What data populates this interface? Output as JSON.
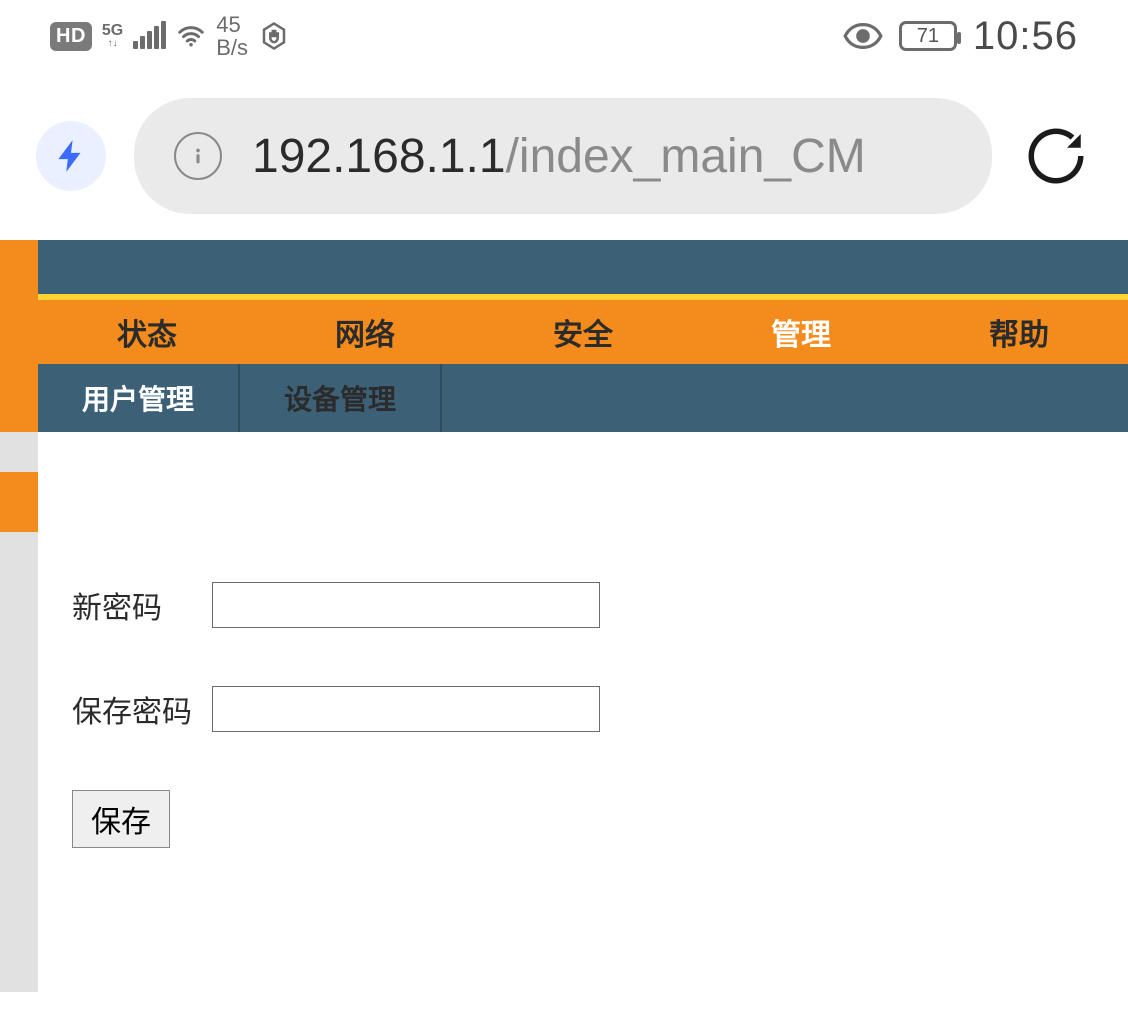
{
  "statusbar": {
    "hd": "HD",
    "fiveg_top": "5G",
    "fiveg_bottom": "↑↓",
    "speed_value": "45",
    "speed_unit": "B/s",
    "battery": "71",
    "time": "10:56"
  },
  "browser": {
    "url_main": "192.168.1.1",
    "url_path": "/index_main_CM"
  },
  "nav": {
    "items": [
      "状态",
      "网络",
      "安全",
      "管理",
      "帮助"
    ],
    "active_index": 3
  },
  "subnav": {
    "items": [
      "用户管理",
      "设备管理"
    ],
    "active_index": 0
  },
  "form": {
    "new_password_label": "新密码",
    "confirm_password_label": "保存密码",
    "save_button": "保存"
  }
}
